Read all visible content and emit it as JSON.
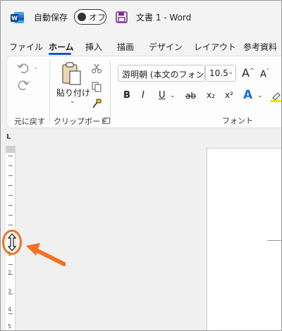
{
  "titlebar": {
    "autosave_label": "自動保存",
    "autosave_state": "オフ",
    "document_title": "文書 1 - Word"
  },
  "tabs": [
    {
      "label": "ファイル"
    },
    {
      "label": "ホーム",
      "active": true
    },
    {
      "label": "挿入"
    },
    {
      "label": "描画"
    },
    {
      "label": "デザイン"
    },
    {
      "label": "レイアウト"
    },
    {
      "label": "参考資料"
    }
  ],
  "ribbon": {
    "undo_group_label": "元に戻す",
    "clipboard_group_label": "クリップボード",
    "paste_label": "貼り付け",
    "font_name": "游明朝 (本文のフォン",
    "font_size": "10.5",
    "font_group_label": "フォント",
    "format_buttons": [
      "B",
      "I",
      "U",
      "ab",
      "x₂",
      "x²",
      "A"
    ]
  },
  "ruler": {
    "corner_glyph": "L",
    "numbers": [
      "1",
      "2",
      "3",
      "4",
      "5"
    ]
  },
  "colors": {
    "accent": "#185abd",
    "highlight": "#f37021",
    "word_brand": "#185abd"
  }
}
